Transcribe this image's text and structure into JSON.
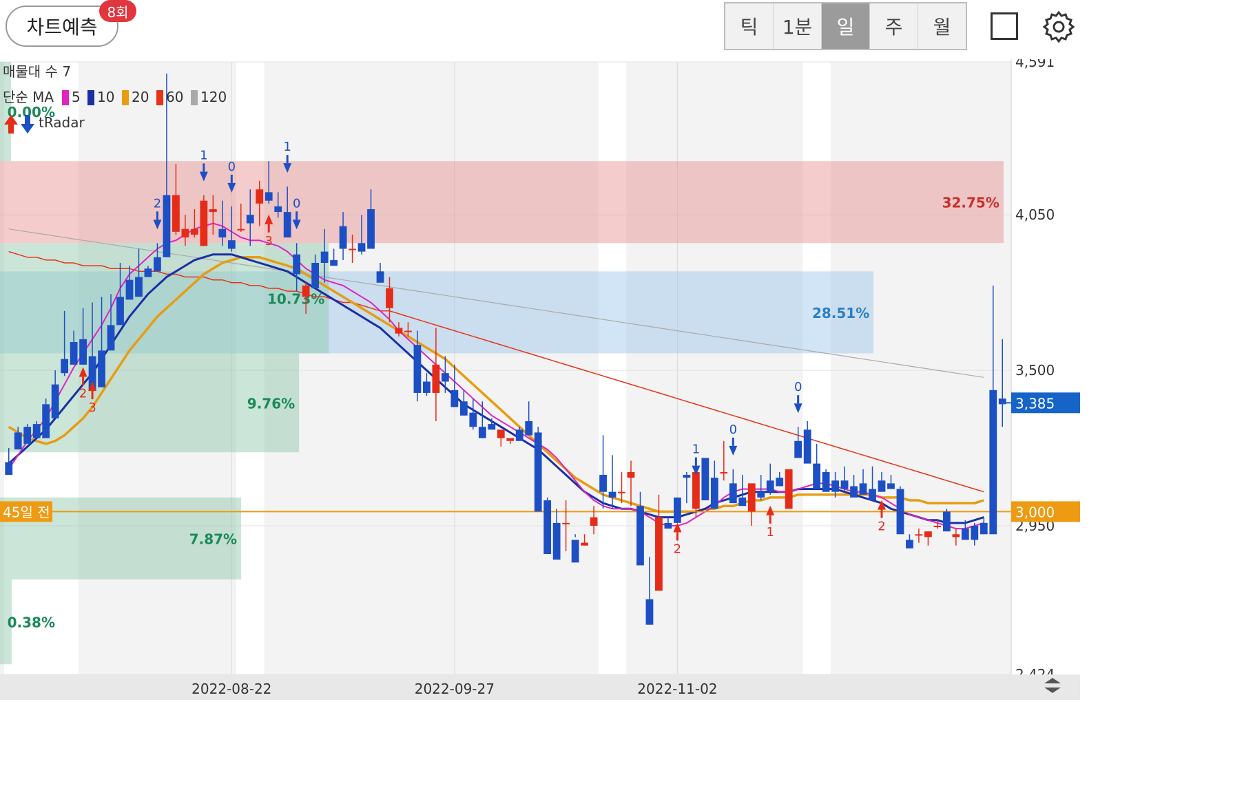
{
  "header": {
    "predict_label": "차트예측",
    "predict_count": "8회",
    "period_tabs": [
      "틱",
      "1분",
      "일",
      "주",
      "월"
    ],
    "active_period": "일",
    "square_icon": "fullscreen-square-icon",
    "settings_icon": "gear-icon"
  },
  "legend": {
    "volume_profile": "매물대 수 7",
    "ma_prefix": "단순 MA",
    "ma_periods": [
      {
        "label": "5",
        "color": "#e023c1"
      },
      {
        "label": "10",
        "color": "#1a2fa3"
      },
      {
        "label": "20",
        "color": "#e79c12"
      },
      {
        "label": "60",
        "color": "#e83317"
      },
      {
        "label": "120",
        "color": "#a9a9a9"
      }
    ],
    "radar_label": "tRadar"
  },
  "chart_data": {
    "type": "candlestick",
    "y_ticks": [
      "4,591",
      "4,050",
      "3,500",
      "2,950",
      "2,424"
    ],
    "ylim": [
      2424,
      4591
    ],
    "x_ticks": [
      "2022-08-22",
      "2022-09-27",
      "2022-11-02"
    ],
    "current_price_label": "3,385",
    "ref_price_label": "3,000",
    "ref_line_label": "45일 전",
    "colors": {
      "up": "#e52c18",
      "down": "#1d4fc4",
      "current": "#1664c8",
      "ref": "#ee9a12"
    },
    "candles": [
      [
        3175,
        3225,
        3150,
        3130
      ],
      [
        3280,
        3300,
        3280,
        3220
      ],
      [
        3300,
        3310,
        3260,
        3240
      ],
      [
        3310,
        3320,
        3310,
        3260
      ],
      [
        3380,
        3400,
        3290,
        3260
      ],
      [
        3450,
        3500,
        3360,
        3330
      ],
      [
        3540,
        3710,
        3480,
        3490
      ],
      [
        3600,
        3640,
        3520,
        3520
      ],
      [
        3610,
        3720,
        3550,
        3520
      ],
      [
        3550,
        3740,
        3500,
        3430
      ],
      [
        3570,
        3760,
        3500,
        3440
      ],
      [
        3660,
        3770,
        3580,
        3570
      ],
      [
        3760,
        3880,
        3680,
        3660
      ],
      [
        3820,
        3870,
        3790,
        3750
      ],
      [
        3830,
        3930,
        3770,
        3760
      ],
      [
        3860,
        3870,
        3850,
        3830
      ],
      [
        3900,
        3950,
        3860,
        3850
      ],
      [
        4120,
        4550,
        3900,
        3900
      ],
      [
        3990,
        4230,
        3980,
        4120
      ],
      [
        3970,
        4050,
        3940,
        4000
      ],
      [
        3980,
        4070,
        3970,
        4000
      ],
      [
        3940,
        4120,
        3940,
        4100
      ],
      [
        4060,
        4120,
        3980,
        4070
      ],
      [
        4000,
        4100,
        3940,
        3970
      ],
      [
        3960,
        4080,
        3920,
        3930
      ],
      [
        4000,
        4090,
        3990,
        4000
      ],
      [
        4050,
        4140,
        3940,
        4020
      ],
      [
        4090,
        4170,
        4010,
        4140
      ],
      [
        4130,
        4240,
        4090,
        4100
      ],
      [
        4080,
        4130,
        4040,
        4060
      ],
      [
        4060,
        4150,
        4000,
        3970
      ],
      [
        3910,
        3950,
        3780,
        3840
      ],
      [
        3760,
        3810,
        3700,
        3800
      ],
      [
        3880,
        3910,
        3870,
        3790
      ],
      [
        3920,
        4000,
        3810,
        3880
      ],
      [
        3890,
        3930,
        3870,
        3870
      ],
      [
        4010,
        4060,
        3890,
        3930
      ],
      [
        3930,
        3980,
        3880,
        3930
      ],
      [
        3950,
        4050,
        3910,
        3920
      ],
      [
        4070,
        4140,
        3970,
        3930
      ],
      [
        3850,
        3880,
        3820,
        3810
      ],
      [
        3720,
        3830,
        3670,
        3790
      ],
      [
        3630,
        3670,
        3620,
        3650
      ],
      [
        3640,
        3670,
        3620,
        3640
      ],
      [
        3590,
        3640,
        3390,
        3420
      ],
      [
        3460,
        3490,
        3410,
        3420
      ],
      [
        3420,
        3650,
        3320,
        3520
      ],
      [
        3490,
        3550,
        3420,
        3460
      ],
      [
        3430,
        3520,
        3380,
        3370
      ],
      [
        3390,
        3430,
        3350,
        3340
      ],
      [
        3350,
        3400,
        3290,
        3300
      ],
      [
        3300,
        3390,
        3280,
        3260
      ],
      [
        3310,
        3330,
        3300,
        3290
      ],
      [
        3260,
        3280,
        3230,
        3290
      ],
      [
        3250,
        3250,
        3240,
        3260
      ],
      [
        3290,
        3300,
        3250,
        3250
      ],
      [
        3320,
        3390,
        3270,
        3270
      ],
      [
        3280,
        3300,
        3150,
        3000
      ],
      [
        3040,
        3050,
        2890,
        2850
      ],
      [
        2960,
        3010,
        2850,
        2830
      ],
      [
        2960,
        3040,
        2860,
        2960
      ],
      [
        2900,
        2920,
        2910,
        2820
      ],
      [
        2880,
        2920,
        2880,
        2890
      ],
      [
        2950,
        3020,
        2920,
        2980
      ],
      [
        3130,
        3270,
        3010,
        3070
      ],
      [
        3070,
        3200,
        3010,
        3050
      ],
      [
        3070,
        3140,
        3030,
        3070
      ],
      [
        3120,
        3180,
        3020,
        3140
      ],
      [
        3020,
        3070,
        2890,
        2810
      ],
      [
        2690,
        2840,
        2600,
        2600
      ],
      [
        2720,
        3060,
        2720,
        2980
      ],
      [
        2960,
        2980,
        2940,
        2940
      ],
      [
        3050,
        3050,
        3000,
        2960
      ],
      [
        3130,
        3140,
        3030,
        3120
      ],
      [
        3010,
        3080,
        2980,
        3140
      ],
      [
        3190,
        3190,
        3060,
        3040
      ],
      [
        3120,
        3180,
        3060,
        3010
      ],
      [
        3140,
        3250,
        3110,
        3140
      ],
      [
        3100,
        3150,
        3070,
        3030
      ],
      [
        3050,
        3130,
        3030,
        3020
      ],
      [
        3000,
        3010,
        2950,
        3100
      ],
      [
        3070,
        3130,
        3040,
        3050
      ],
      [
        3110,
        3170,
        3060,
        3070
      ],
      [
        3120,
        3140,
        3100,
        3090
      ],
      [
        3010,
        3120,
        3010,
        3150
      ],
      [
        3250,
        3300,
        3220,
        3190
      ],
      [
        3290,
        3320,
        3210,
        3170
      ],
      [
        3170,
        3240,
        3090,
        3080
      ],
      [
        3140,
        3150,
        3090,
        3070
      ],
      [
        3110,
        3140,
        3050,
        3070
      ],
      [
        3110,
        3160,
        3070,
        3080
      ],
      [
        3090,
        3130,
        3060,
        3050
      ],
      [
        3100,
        3150,
        3080,
        3060
      ],
      [
        3080,
        3160,
        3060,
        3040
      ],
      [
        3110,
        3140,
        3080,
        3070
      ],
      [
        3100,
        3130,
        3100,
        3080
      ],
      [
        3080,
        3090,
        3040,
        2920
      ],
      [
        2900,
        2920,
        2880,
        2870
      ],
      [
        2920,
        2940,
        2890,
        2920
      ],
      [
        2910,
        2930,
        2880,
        2930
      ],
      [
        2950,
        2970,
        2940,
        2950
      ],
      [
        3000,
        3010,
        2950,
        2930
      ],
      [
        2910,
        2940,
        2880,
        2920
      ],
      [
        2940,
        2970,
        2920,
        2900
      ],
      [
        2950,
        2960,
        2880,
        2900
      ],
      [
        2960,
        2980,
        2920,
        2920
      ],
      [
        3430,
        3800,
        3120,
        2920
      ],
      [
        3400,
        3610,
        3300,
        3380
      ]
    ],
    "volume_bands": [
      {
        "label": "32.75%",
        "from": 3950,
        "to": 4240,
        "color": "#e98f8f"
      },
      {
        "label": "28.51%",
        "from": 3560,
        "to": 3850,
        "color": "#9ac5ea"
      },
      {
        "label": "9.76%",
        "from": 3210,
        "to": 3560,
        "color": "#8cc7a8"
      },
      {
        "label": "10.73%",
        "from": 3560,
        "to": 3950,
        "color": "#8cc7a8"
      },
      {
        "label": "7.87%",
        "from": 2760,
        "to": 3050,
        "color": "#8cc7a8"
      },
      {
        "label": "0.38%",
        "from": 2460,
        "to": 2760,
        "color": "#8cc7a8"
      },
      {
        "label": "0.00%",
        "from": 4240,
        "to": 4591,
        "color": "#8cc7a8"
      }
    ],
    "signals": [
      {
        "dir": "up",
        "index": 8,
        "label": "2"
      },
      {
        "dir": "up",
        "index": 9,
        "label": "3"
      },
      {
        "dir": "down",
        "index": 16,
        "label": "2"
      },
      {
        "dir": "down",
        "index": 21,
        "label": "1"
      },
      {
        "dir": "down",
        "index": 24,
        "label": "0"
      },
      {
        "dir": "up",
        "index": 28,
        "label": "3"
      },
      {
        "dir": "down",
        "index": 30,
        "label": "1"
      },
      {
        "dir": "down",
        "index": 31,
        "label": "0"
      },
      {
        "dir": "up",
        "index": 72,
        "label": "2"
      },
      {
        "dir": "down",
        "index": 74,
        "label": "1"
      },
      {
        "dir": "down",
        "index": 78,
        "label": "0"
      },
      {
        "dir": "up",
        "index": 82,
        "label": "1"
      },
      {
        "dir": "down",
        "index": 85,
        "label": "0"
      },
      {
        "dir": "up",
        "index": 94,
        "label": "2"
      }
    ],
    "ma_series": {
      "5": [
        3150,
        3200,
        3250,
        3290,
        3330,
        3390,
        3450,
        3510,
        3560,
        3610,
        3660,
        3720,
        3790,
        3840,
        3870,
        3900,
        3930,
        3950,
        3960,
        3980,
        4000,
        4010,
        4020,
        4010,
        3990,
        3970,
        3960,
        3960,
        3950,
        3940,
        3920,
        3890,
        3860,
        3840,
        3820,
        3810,
        3800,
        3780,
        3760,
        3740,
        3710,
        3680,
        3640,
        3610,
        3580,
        3550,
        3520,
        3490,
        3460,
        3430,
        3400,
        3370,
        3340,
        3320,
        3300,
        3280,
        3260,
        3240,
        3220,
        3190,
        3150,
        3110,
        3070,
        3040,
        3020,
        3010,
        3010,
        3010,
        3000,
        2980,
        2960,
        2950,
        2950,
        2960,
        2980,
        3000,
        3020,
        3050,
        3070,
        3080,
        3080,
        3080,
        3080,
        3070,
        3070,
        3080,
        3090,
        3100,
        3100,
        3090,
        3080,
        3070,
        3070,
        3060,
        3050,
        3030,
        3010,
        2990,
        2980,
        2970,
        2960,
        2950,
        2940,
        2940,
        2950,
        2960
      ],
      "10": [
        3170,
        3200,
        3230,
        3260,
        3290,
        3330,
        3370,
        3410,
        3450,
        3490,
        3540,
        3590,
        3640,
        3690,
        3730,
        3770,
        3800,
        3830,
        3850,
        3870,
        3890,
        3900,
        3910,
        3910,
        3910,
        3900,
        3890,
        3880,
        3870,
        3860,
        3850,
        3830,
        3810,
        3790,
        3770,
        3750,
        3730,
        3710,
        3690,
        3670,
        3650,
        3620,
        3590,
        3560,
        3530,
        3500,
        3470,
        3440,
        3410,
        3380,
        3360,
        3340,
        3320,
        3300,
        3280,
        3260,
        3240,
        3220,
        3190,
        3160,
        3130,
        3100,
        3070,
        3050,
        3030,
        3020,
        3010,
        3010,
        3000,
        2990,
        2980,
        2980,
        2980,
        2990,
        3000,
        3010,
        3030,
        3040,
        3050,
        3060,
        3070,
        3070,
        3070,
        3070,
        3070,
        3080,
        3080,
        3080,
        3080,
        3080,
        3070,
        3060,
        3050,
        3040,
        3030,
        3010,
        3000,
        2990,
        2980,
        2970,
        2970,
        2960,
        2960,
        2960,
        2970,
        2980
      ],
      "20": [
        3300,
        3280,
        3260,
        3250,
        3240,
        3250,
        3270,
        3300,
        3330,
        3370,
        3420,
        3470,
        3520,
        3570,
        3610,
        3650,
        3690,
        3720,
        3750,
        3780,
        3810,
        3840,
        3860,
        3880,
        3890,
        3900,
        3900,
        3900,
        3890,
        3880,
        3870,
        3860,
        3840,
        3820,
        3800,
        3780,
        3760,
        3740,
        3720,
        3700,
        3680,
        3660,
        3640,
        3620,
        3600,
        3580,
        3560,
        3540,
        3510,
        3480,
        3450,
        3420,
        3390,
        3360,
        3330,
        3300,
        3270,
        3240,
        3210,
        3180,
        3150,
        3120,
        3100,
        3080,
        3060,
        3050,
        3040,
        3030,
        3020,
        3010,
        3000,
        3000,
        3000,
        3000,
        3000,
        3010,
        3010,
        3020,
        3020,
        3030,
        3040,
        3040,
        3050,
        3050,
        3050,
        3060,
        3060,
        3060,
        3060,
        3060,
        3060,
        3060,
        3060,
        3060,
        3050,
        3050,
        3050,
        3040,
        3040,
        3030,
        3030,
        3030,
        3030,
        3030,
        3030,
        3040
      ],
      "60": [
        3920,
        3910,
        3900,
        3900,
        3890,
        3890,
        3880,
        3880,
        3870,
        3870,
        3870,
        3860,
        3860,
        3860,
        3850,
        3850,
        3850,
        3840,
        3840,
        3830,
        3830,
        3830,
        3820,
        3820,
        3810,
        3810,
        3800,
        3800,
        3790,
        3790,
        3780,
        3780,
        3770,
        3760,
        3760,
        3750,
        3740,
        3740,
        3730,
        3720,
        3710,
        3710,
        3700,
        3690,
        3680,
        3670,
        3660,
        3650,
        3640,
        3630,
        3620,
        3610,
        3600,
        3590,
        3580,
        3570,
        3560,
        3550,
        3540,
        3530,
        3520,
        3510,
        3500,
        3490,
        3480,
        3470,
        3460,
        3450,
        3440,
        3430,
        3420,
        3410,
        3400,
        3390,
        3380,
        3370,
        3360,
        3350,
        3340,
        3330,
        3320,
        3310,
        3300,
        3290,
        3280,
        3270,
        3260,
        3250,
        3240,
        3230,
        3220,
        3210,
        3200,
        3190,
        3180,
        3170,
        3160,
        3150,
        3140,
        3130,
        3120,
        3110,
        3100,
        3090,
        3080,
        3070
      ],
      "120": [
        4000,
        3995,
        3990,
        3985,
        3980,
        3975,
        3970,
        3965,
        3960,
        3955,
        3950,
        3945,
        3940,
        3935,
        3930,
        3925,
        3920,
        3915,
        3910,
        3905,
        3900,
        3895,
        3890,
        3885,
        3880,
        3875,
        3870,
        3865,
        3860,
        3855,
        3850,
        3845,
        3840,
        3835,
        3830,
        3825,
        3820,
        3815,
        3810,
        3805,
        3800,
        3795,
        3790,
        3785,
        3780,
        3775,
        3770,
        3765,
        3760,
        3755,
        3750,
        3745,
        3740,
        3735,
        3730,
        3725,
        3720,
        3715,
        3710,
        3705,
        3700,
        3695,
        3690,
        3685,
        3680,
        3675,
        3670,
        3665,
        3660,
        3655,
        3650,
        3645,
        3640,
        3635,
        3630,
        3625,
        3620,
        3615,
        3610,
        3605,
        3600,
        3595,
        3590,
        3585,
        3580,
        3575,
        3570,
        3565,
        3560,
        3555,
        3550,
        3545,
        3540,
        3535,
        3530,
        3525,
        3520,
        3515,
        3510,
        3505,
        3500,
        3495,
        3490,
        3485,
        3480,
        3475
      ]
    }
  }
}
